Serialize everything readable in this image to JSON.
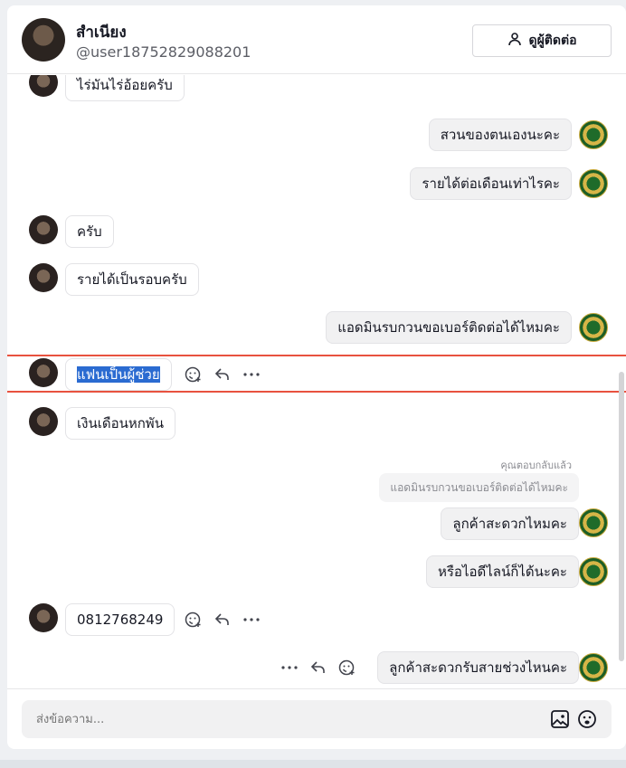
{
  "header": {
    "name": "สำเนียง",
    "handle": "@user18752829088201",
    "view_contact_label": "ดูผู้ติดต่อ"
  },
  "messages": [
    {
      "side": "left",
      "text": "ไร่มันไร่อ้อยครับ"
    },
    {
      "side": "right",
      "text": "สวนของตนเองนะคะ"
    },
    {
      "side": "right",
      "text": "รายได้ต่อเดือนเท่าไรคะ"
    },
    {
      "side": "left",
      "text": "ครับ"
    },
    {
      "side": "left",
      "text": "รายได้เป็นรอบครับ"
    },
    {
      "side": "right",
      "text": "แอดมินรบกวนขอเบอร์ติดต่อได้ไหมคะ"
    },
    {
      "side": "left",
      "text": "แฟนเป็นผู้ช่วย",
      "selected": true
    },
    {
      "side": "left",
      "text": "เงินเดือนหกพัน"
    },
    {
      "side": "right",
      "text": "ลูกค้าสะดวกไหมคะ",
      "reply_label": "คุณตอบกลับแล้ว",
      "quote": "แอดมินรบกวนขอเบอร์ติดต่อได้ไหมคะ"
    },
    {
      "side": "right",
      "text": "หรือไอดีไลน์ก็ได้นะคะ"
    },
    {
      "side": "left",
      "text": "0812768249"
    },
    {
      "side": "right",
      "text": "ลูกค้าสะดวกรับสายช่วงไหนคะ"
    }
  ],
  "composer": {
    "placeholder": "ส่งข้อความ..."
  },
  "icons": {
    "view_contact": "person-icon",
    "react": "emoji-add-icon",
    "reply": "reply-icon",
    "more": "more-icon",
    "image": "image-icon",
    "emoji": "emoji-icon"
  },
  "colors": {
    "highlight_border": "#e8523f",
    "selection": "#2a6bd1"
  }
}
